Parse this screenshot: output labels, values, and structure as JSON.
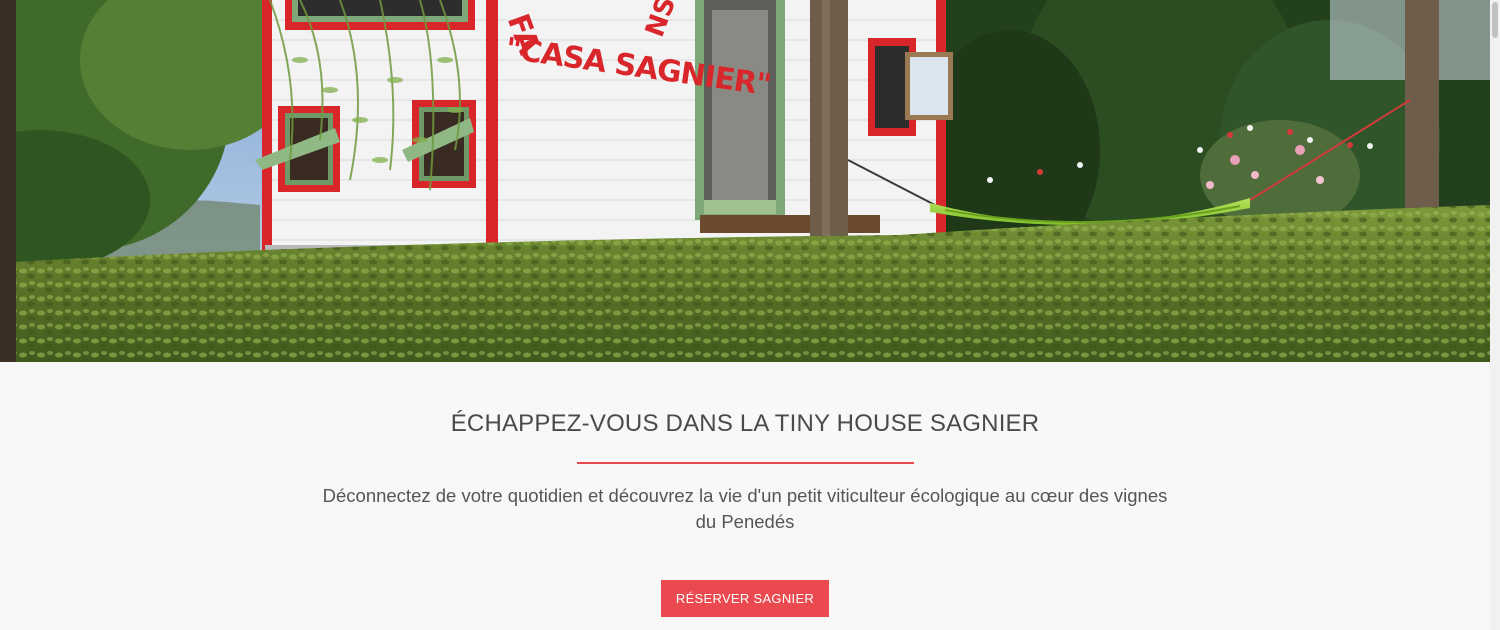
{
  "hero": {
    "sign_top_text": "FA          NS",
    "sign_main_text": "\"CASA SAGNIER\"",
    "colors": {
      "sky": "#8fb2d8",
      "house_wall": "#f2f2f2",
      "house_trim": "#d8262b",
      "window_frame": "#7fa878",
      "hedge": "#5f7a2c",
      "hammock": "#9ad43f"
    }
  },
  "main": {
    "headline": "ÉCHAPPEZ-VOUS DANS LA TINY HOUSE SAGNIER",
    "subtitle": "Déconnectez de votre quotidien et découvrez la vie d'un petit viticulteur écologique au cœur des vignes du Penedés",
    "cta_label": "RÉSERVER SAGNIER"
  },
  "colors": {
    "accent": "#ea4a4f",
    "background": "#f8f8f8",
    "headline_text": "#4a4a4a"
  }
}
